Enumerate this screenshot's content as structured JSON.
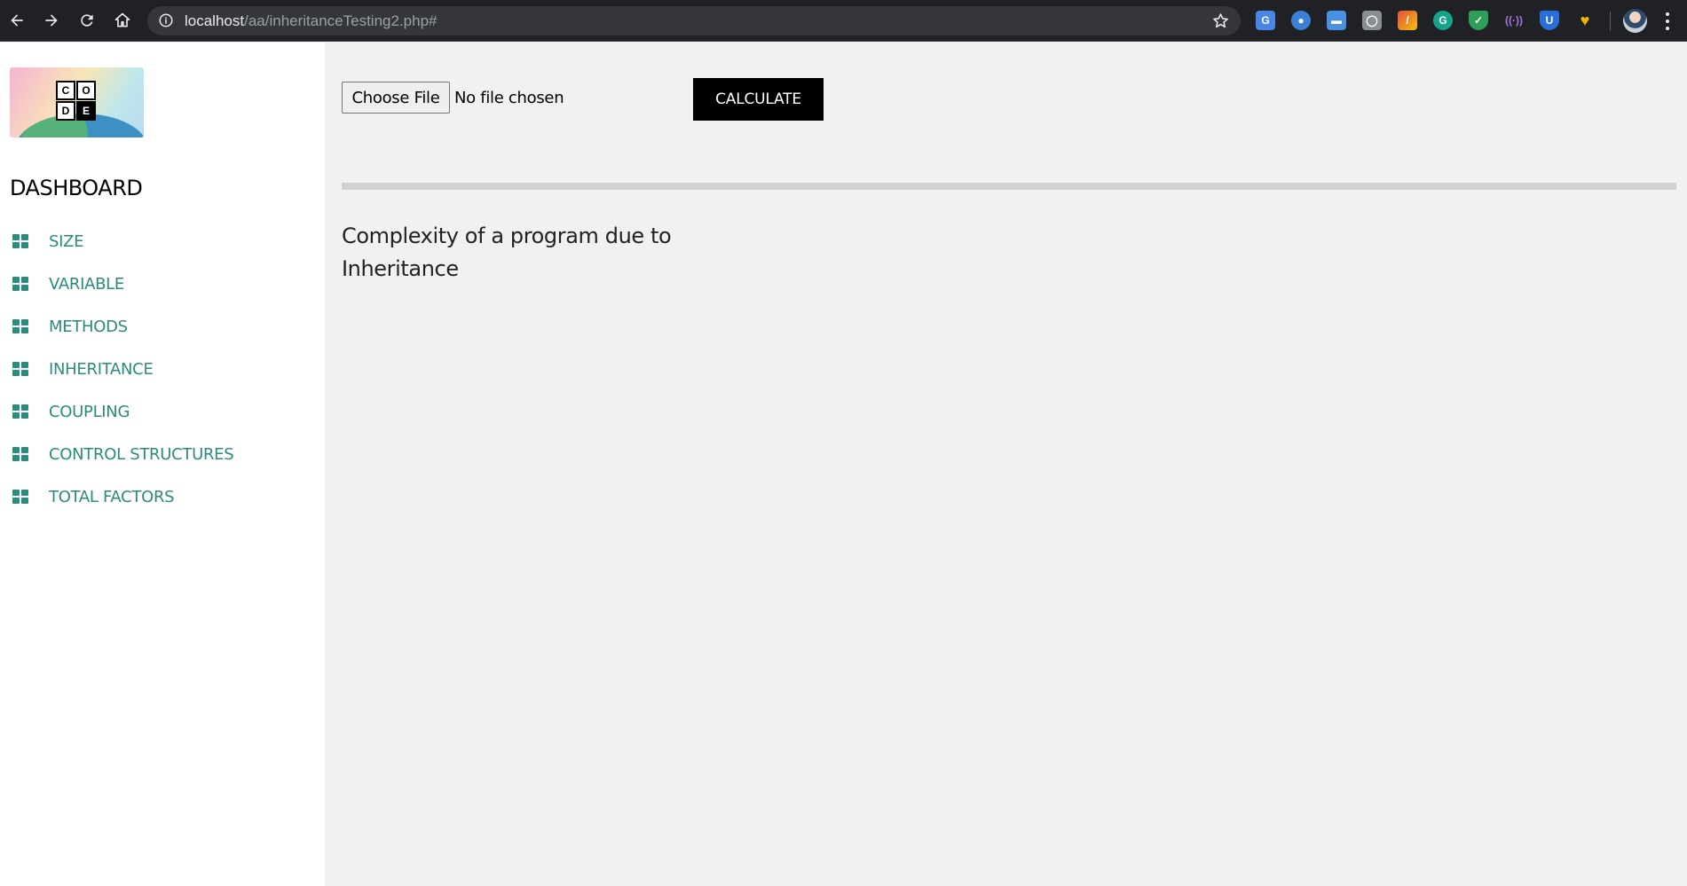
{
  "browser": {
    "url_host": "localhost",
    "url_path": "/aa/inheritanceTesting2.php#",
    "extension_icons": [
      "translate-icon",
      "camera-icon",
      "window-icon",
      "bulb-icon",
      "pen-icon",
      "grammarly-icon",
      "shield-icon",
      "wave-icon",
      "bitwarden-icon",
      "heart-icon"
    ]
  },
  "sidebar": {
    "logo_letters": [
      "C",
      "O",
      "D",
      "E"
    ],
    "title": "DASHBOARD",
    "items": [
      {
        "label": "SIZE"
      },
      {
        "label": "VARIABLE"
      },
      {
        "label": "METHODS"
      },
      {
        "label": "INHERITANCE"
      },
      {
        "label": "COUPLING"
      },
      {
        "label": "CONTROL STRUCTURES"
      },
      {
        "label": "TOTAL FACTORS"
      }
    ],
    "accent_color": "#2b8c7e"
  },
  "main": {
    "file_button": "Choose File",
    "file_status": "No file chosen",
    "calculate_button": "CALCULATE",
    "heading_line1": "Complexity of a program due to",
    "heading_line2": "Inheritance"
  }
}
